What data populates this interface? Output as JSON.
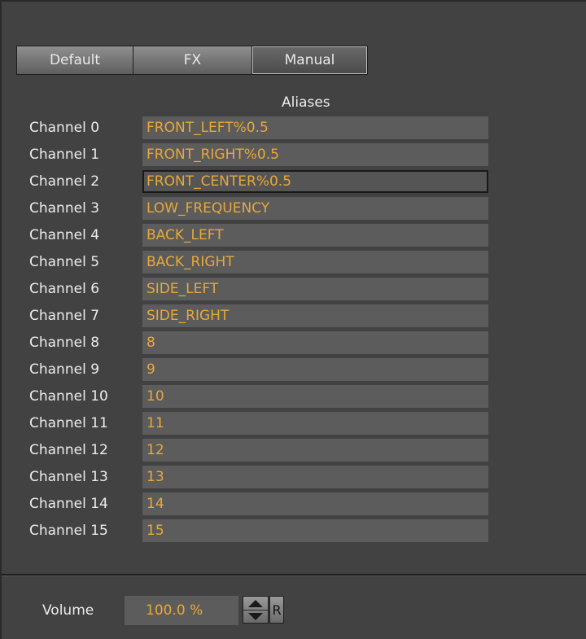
{
  "tabs": [
    {
      "label": "Default"
    },
    {
      "label": "FX"
    },
    {
      "label": "Manual"
    }
  ],
  "aliases_header": "Aliases",
  "channels": [
    {
      "label": "Channel 0",
      "alias": "FRONT_LEFT%0.5"
    },
    {
      "label": "Channel 1",
      "alias": "FRONT_RIGHT%0.5"
    },
    {
      "label": "Channel 2",
      "alias": "FRONT_CENTER%0.5"
    },
    {
      "label": "Channel 3",
      "alias": "LOW_FREQUENCY"
    },
    {
      "label": "Channel 4",
      "alias": "BACK_LEFT"
    },
    {
      "label": "Channel 5",
      "alias": "BACK_RIGHT"
    },
    {
      "label": "Channel 6",
      "alias": "SIDE_LEFT"
    },
    {
      "label": "Channel 7",
      "alias": "SIDE_RIGHT"
    },
    {
      "label": "Channel 8",
      "alias": "8"
    },
    {
      "label": "Channel 9",
      "alias": "9"
    },
    {
      "label": "Channel 10",
      "alias": "10"
    },
    {
      "label": "Channel 11",
      "alias": "11"
    },
    {
      "label": "Channel 12",
      "alias": "12"
    },
    {
      "label": "Channel 13",
      "alias": "13"
    },
    {
      "label": "Channel 14",
      "alias": "14"
    },
    {
      "label": "Channel 15",
      "alias": "15"
    }
  ],
  "volume": {
    "label": "Volume",
    "value": "100.0 %",
    "reset_label": "R"
  },
  "colors": {
    "value_text": "#e8a838",
    "field_bg": "#5c5c5c",
    "panel_bg": "#424242"
  }
}
